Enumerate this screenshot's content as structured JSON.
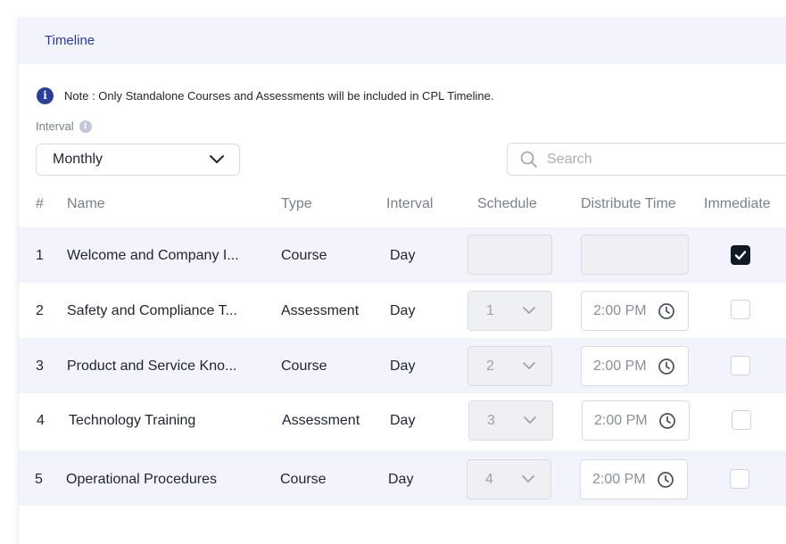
{
  "header": {
    "title": "Timeline"
  },
  "note": {
    "text": "Note : Only Standalone Courses and Assessments will be included in CPL Timeline."
  },
  "interval": {
    "label": "Interval",
    "selected": "Monthly"
  },
  "search": {
    "placeholder": "Search"
  },
  "table": {
    "headers": [
      "#",
      "Name",
      "Type",
      "Interval",
      "Schedule",
      "Distribute Time",
      "Immediate"
    ],
    "rows": [
      {
        "num": "1",
        "name": "Welcome and Company I...",
        "type": "Course",
        "interval": "Day",
        "schedule": "",
        "time": "",
        "immediate": true
      },
      {
        "num": "2",
        "name": "Safety and Compliance T...",
        "type": "Assessment",
        "interval": "Day",
        "schedule": "1",
        "time": "2:00 PM",
        "immediate": false
      },
      {
        "num": "3",
        "name": "Product and Service Kno...",
        "type": "Course",
        "interval": "Day",
        "schedule": "2",
        "time": "2:00 PM",
        "immediate": false
      },
      {
        "num": "4",
        "name": "Technology Training",
        "type": "Assessment",
        "interval": "Day",
        "schedule": "3",
        "time": "2:00 PM",
        "immediate": false
      },
      {
        "num": "5",
        "name": "Operational Procedures",
        "type": "Course",
        "interval": "Day",
        "schedule": "4",
        "time": "2:00 PM",
        "immediate": false
      }
    ]
  },
  "icons": {
    "info": "info-icon",
    "search": "search-icon",
    "chevron": "chevron-down-icon",
    "clock": "clock-icon",
    "check": "check-icon"
  },
  "colors": {
    "accent": "#2f3aa6",
    "header_bg": "#f3f4fb",
    "checked": "#111827"
  }
}
